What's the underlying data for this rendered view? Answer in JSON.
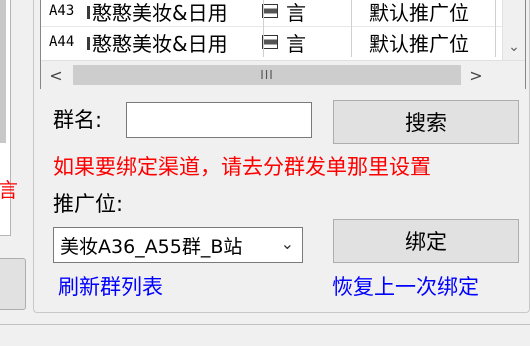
{
  "list": {
    "rows": [
      {
        "id": "A43",
        "name": "憨憨美妆&日用",
        "lang": "言",
        "position": "默认推广位"
      },
      {
        "id": "A44",
        "name": "憨憨美妆&日用",
        "lang": "言",
        "position": "默认推广位"
      }
    ],
    "scroll_thumb_glyph": "III"
  },
  "form": {
    "group_name_label": "群名:",
    "group_name_value": "",
    "search_button": "搜索",
    "notice": "如果要绑定渠道，请去分群发单那里设置",
    "promo_label": "推广位:",
    "promo_selected": "美妆A36_A55群_B站",
    "bind_button": "绑定",
    "refresh_link": "刷新群列表",
    "restore_link": "恢复上一次绑定"
  },
  "left_panel": {
    "partial_glyph": "言"
  },
  "colors": {
    "notice": "#ff0000",
    "link": "#0000ff",
    "panel_bg": "#f0f0f0"
  }
}
